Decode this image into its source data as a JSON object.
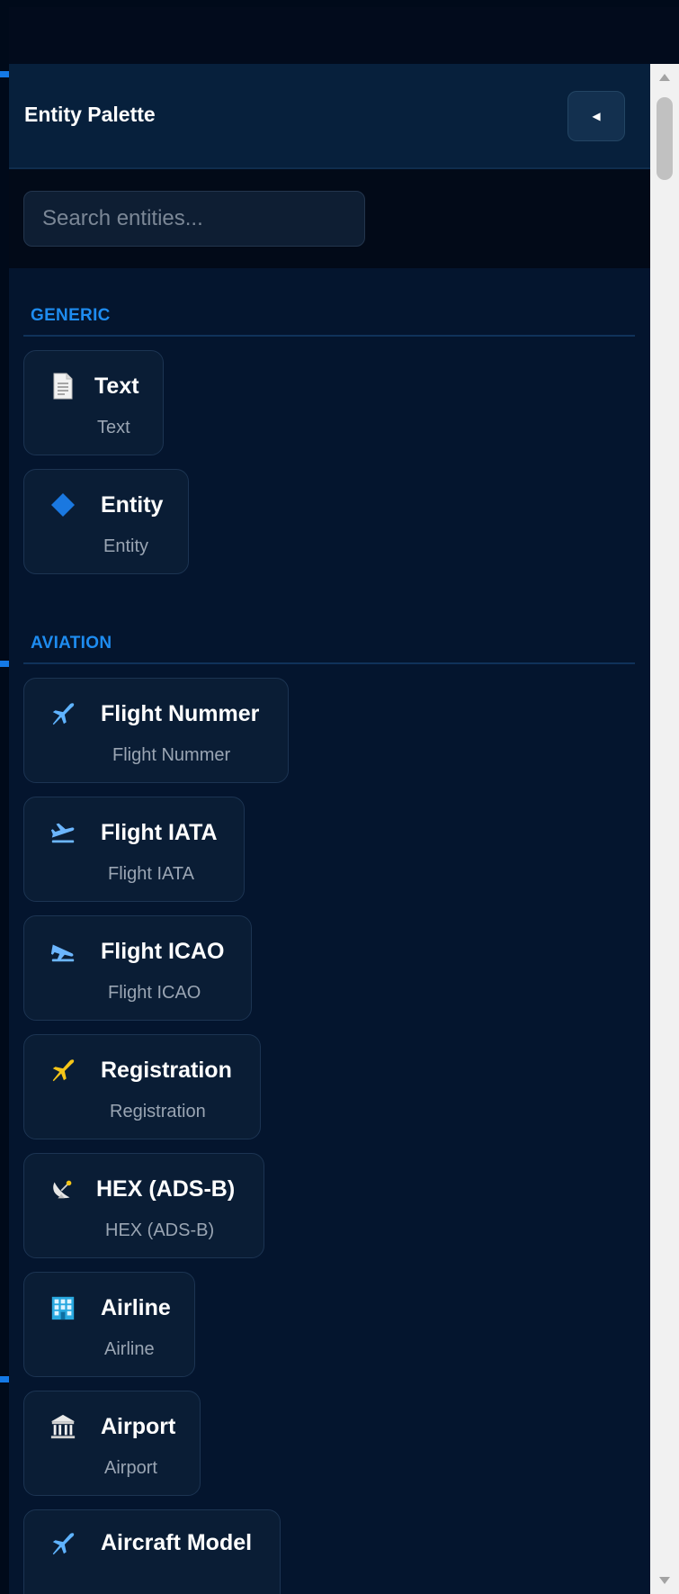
{
  "palette": {
    "title": "Entity Palette",
    "collapse_icon": "triangle-left-icon"
  },
  "search": {
    "placeholder": "Search entities..."
  },
  "sections": [
    {
      "title": "GENERIC",
      "items": [
        {
          "label": "Text",
          "sublabel": "Text",
          "icon": "document-icon"
        },
        {
          "label": "Entity",
          "sublabel": "Entity",
          "icon": "diamond-icon"
        }
      ]
    },
    {
      "title": "AVIATION",
      "items": [
        {
          "label": "Flight Nummer",
          "sublabel": "Flight Nummer",
          "icon": "airplane-icon"
        },
        {
          "label": "Flight IATA",
          "sublabel": "Flight IATA",
          "icon": "airplane-departure-icon"
        },
        {
          "label": "Flight ICAO",
          "sublabel": "Flight ICAO",
          "icon": "airplane-arrival-icon"
        },
        {
          "label": "Registration",
          "sublabel": "Registration",
          "icon": "small-airplane-icon"
        },
        {
          "label": "HEX (ADS-B)",
          "sublabel": "HEX (ADS-B)",
          "icon": "satellite-dish-icon"
        },
        {
          "label": "Airline",
          "sublabel": "Airline",
          "icon": "office-building-icon"
        },
        {
          "label": "Airport",
          "sublabel": "Airport",
          "icon": "classical-building-icon"
        },
        {
          "label": "Aircraft Model",
          "sublabel": "",
          "icon": "airplane-icon"
        }
      ]
    }
  ],
  "colors": {
    "accent": "#1479e6",
    "section_title": "#1e8cf0",
    "panel_bg": "#04152e",
    "card_bg": "#0a1d35"
  }
}
